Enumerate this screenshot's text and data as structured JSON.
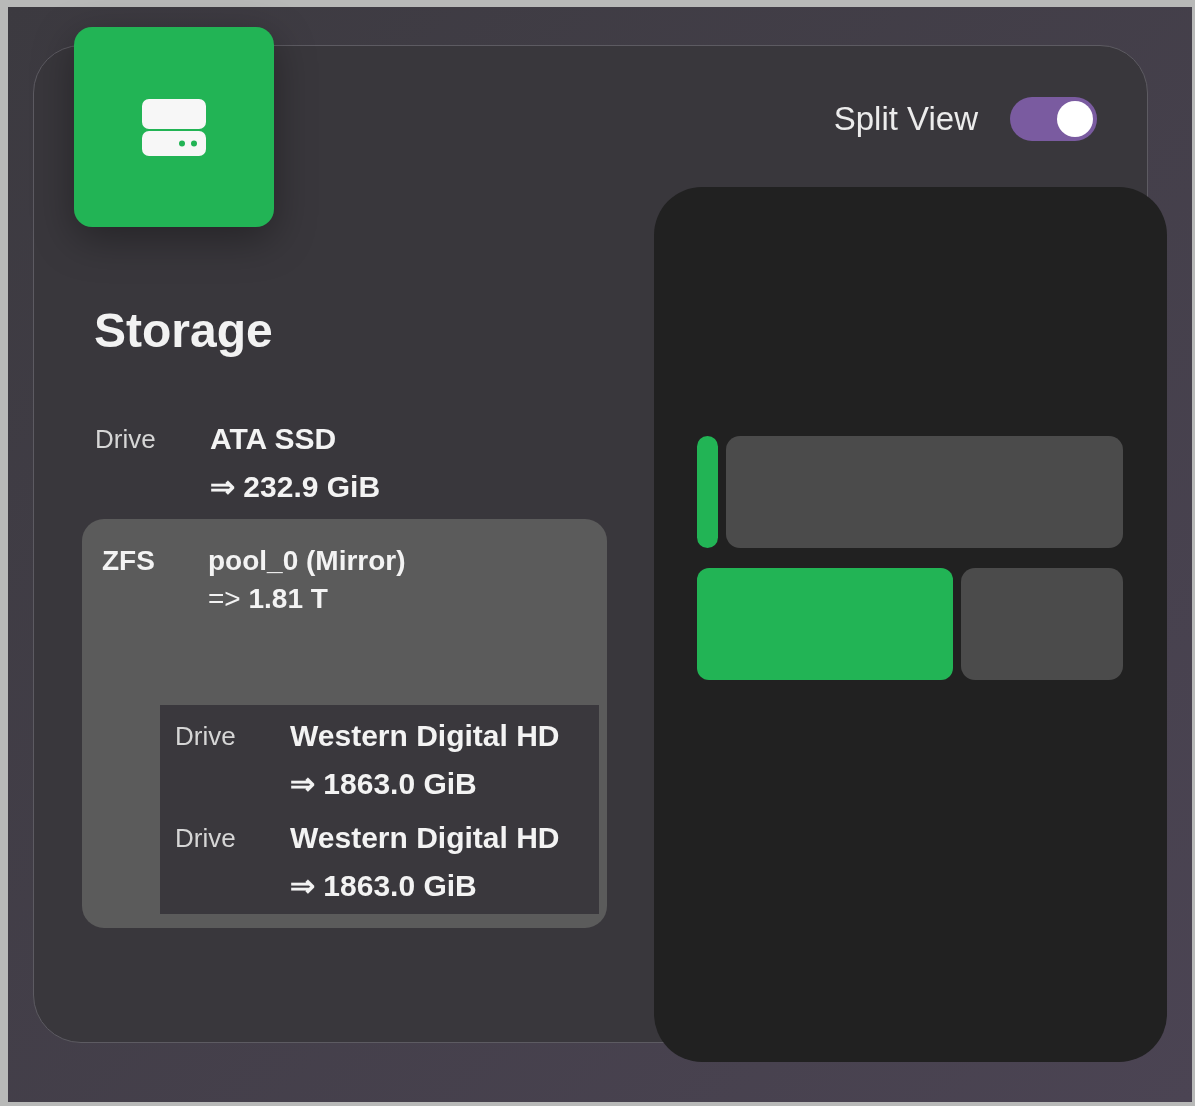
{
  "header": {
    "title": "Storage"
  },
  "split_view": {
    "label": "Split View",
    "on": true
  },
  "devices": [
    {
      "kind": "drive",
      "type_label": "Drive",
      "name": "ATA SSD",
      "size": "⇒ 232.9 GiB"
    },
    {
      "kind": "pool",
      "type_label": "ZFS",
      "name": "pool_0 (Mirror)",
      "size": "=> **1.81 T**",
      "children": [
        {
          "kind": "drive",
          "type_label": "Drive",
          "name": "Western Digital HD",
          "size": "⇒ 1863.0 GiB"
        },
        {
          "kind": "drive",
          "type_label": "Drive",
          "name": "Western Digital HD",
          "size": "⇒ 1863.0 GiB"
        }
      ]
    }
  ],
  "usage_bars": [
    {
      "level": 0.05
    },
    {
      "level": 0.6
    }
  ]
}
